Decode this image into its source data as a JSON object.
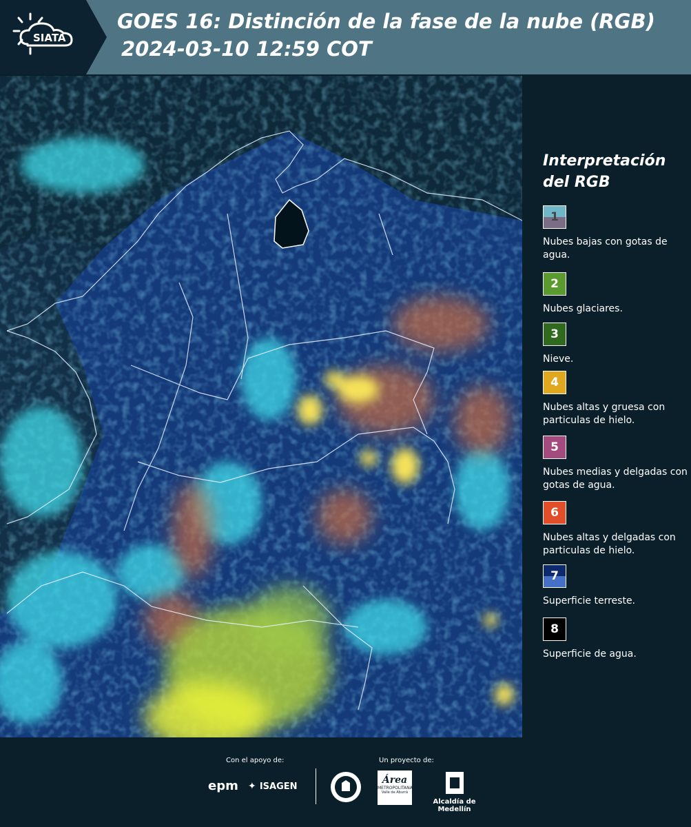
{
  "header": {
    "brand": "SIATA",
    "title_line1": "GOES 16: Distinción de la fase de la nube (RGB)",
    "title_line2": "2024-03-10 12:59 COT"
  },
  "legend": {
    "title": "Interpretación del RGB",
    "items": [
      {
        "number": "1",
        "label": "Nubes bajas con gotas de agua.",
        "color": "#6fb6c9"
      },
      {
        "number": "2",
        "label": "Nubes glaciares.",
        "color": "#5a9a2e"
      },
      {
        "number": "3",
        "label": "Nieve.",
        "color": "#2f6a1f"
      },
      {
        "number": "4",
        "label": "Nubes altas y gruesa con particulas de hielo.",
        "color": "#e0a81f"
      },
      {
        "number": "5",
        "label": "Nubes medias y delgadas con gotas de agua.",
        "color": "#a34a7f"
      },
      {
        "number": "6",
        "label": "Nubes altas y delgadas con particulas de hielo.",
        "color": "#e24e2a"
      },
      {
        "number": "7",
        "label": "Superficie terreste.",
        "color": "#0e2a6e"
      },
      {
        "number": "8",
        "label": "Superficie de agua.",
        "color": "#000000"
      }
    ]
  },
  "footer": {
    "support_label": "Con el apoyo de:",
    "project_label": "Un proyecto de:",
    "sponsor1": "epm",
    "sponsor2": "ISAGEN",
    "partner1_line1": "Área",
    "partner1_line2": "METROPOLITANA",
    "partner1_line3": "Valle de Aburrá",
    "partner2": "Alcaldía de Medellín"
  }
}
